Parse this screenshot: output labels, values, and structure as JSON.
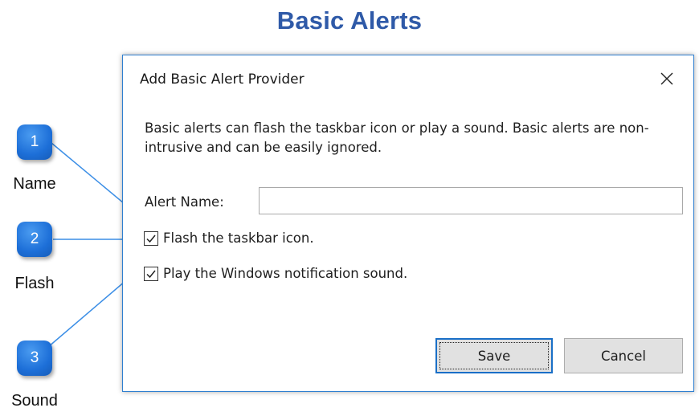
{
  "page": {
    "title": "Basic Alerts"
  },
  "dialog": {
    "title": "Add Basic Alert Provider",
    "close_icon": "close-icon",
    "description": "Basic alerts can flash the taskbar icon or play a sound.  Basic alerts are non-intrusive and can be easily ignored.",
    "alert_name_label": "Alert Name:",
    "alert_name_value": "",
    "flash_label": "Flash the taskbar icon.",
    "flash_checked": true,
    "sound_label": "Play the Windows notification sound.",
    "sound_checked": true,
    "save_label": "Save",
    "cancel_label": "Cancel"
  },
  "callouts": [
    {
      "number": "1",
      "label": "Name"
    },
    {
      "number": "2",
      "label": "Flash"
    },
    {
      "number": "3",
      "label": "Sound"
    }
  ],
  "colors": {
    "title": "#2f5aa8",
    "callout": "#1d6fd8",
    "connector": "#3b8ee6",
    "dialog_border": "#2f7fd0"
  }
}
